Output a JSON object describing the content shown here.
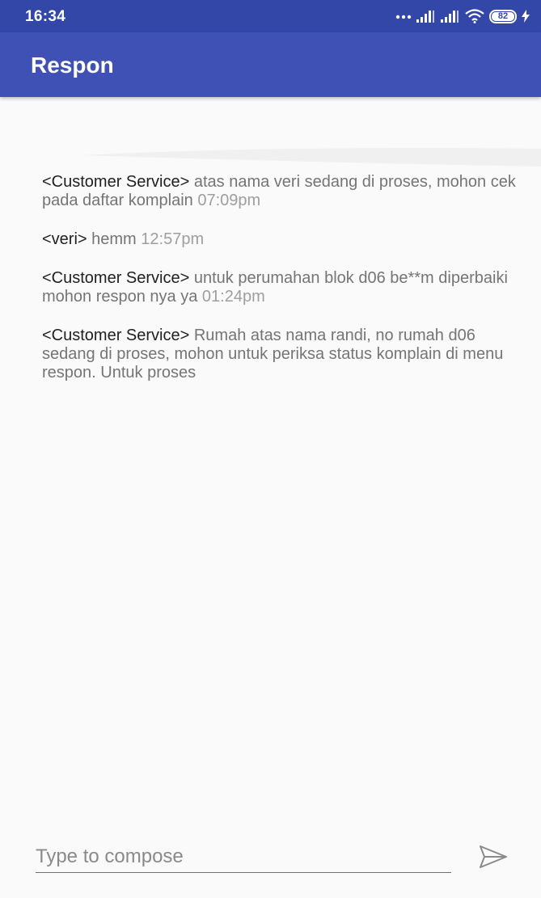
{
  "status_bar": {
    "time": "16:34",
    "battery": "82",
    "icons": [
      "dots-icon",
      "signal-icon",
      "signal-icon",
      "wifi-icon",
      "battery-icon",
      "charging-icon"
    ]
  },
  "app_bar": {
    "title": "Respon"
  },
  "messages": [
    {
      "sender": "<Customer Service>",
      "text": " atas nama veri sedang di proses, mohon cek pada daftar komplain ",
      "time": "07:09pm"
    },
    {
      "sender": "<veri>",
      "text": " hemm ",
      "time": "12:57pm"
    },
    {
      "sender": "<Customer Service>",
      "text": " untuk perumahan blok d06 be**m diperbaiki mohon respon nya ya ",
      "time": "01:24pm"
    },
    {
      "sender": "<Customer Service>",
      "text": " Rumah atas nama randi, no rumah d06 sedang di proses, mohon untuk periksa status komplain di menu respon. Untuk proses",
      "time": ""
    }
  ],
  "compose": {
    "placeholder": "Type to compose",
    "value": ""
  },
  "colors": {
    "status_bar": "#3347a8",
    "app_bar": "#3f51b5",
    "background": "#fafafa"
  }
}
